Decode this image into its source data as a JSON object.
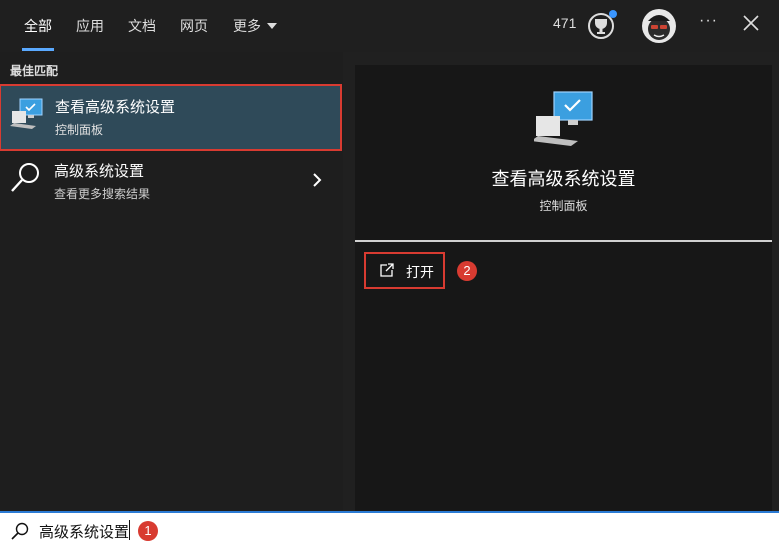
{
  "tabs": [
    {
      "label": "全部",
      "active": true
    },
    {
      "label": "应用"
    },
    {
      "label": "文档"
    },
    {
      "label": "网页"
    },
    {
      "label": "更多"
    }
  ],
  "header": {
    "points": "471",
    "more": "···",
    "icons": {
      "trophy": "trophy-icon",
      "avatar": "avatar",
      "close": "close-icon"
    }
  },
  "results": {
    "section_title": "最佳匹配",
    "best_match": {
      "title": "查看高级系统设置",
      "subtitle": "控制面板"
    },
    "web_result": {
      "title": "高级系统设置",
      "subtitle": "查看更多搜索结果"
    }
  },
  "detail": {
    "title": "查看高级系统设置",
    "subtitle": "控制面板",
    "open_label": "打开"
  },
  "annotations": [
    "1",
    "2"
  ],
  "search": {
    "query": "高级系统设置"
  },
  "colors": {
    "accent": "#5aa9ff",
    "highlight": "#d83b31",
    "selection": "#2f4a59"
  }
}
